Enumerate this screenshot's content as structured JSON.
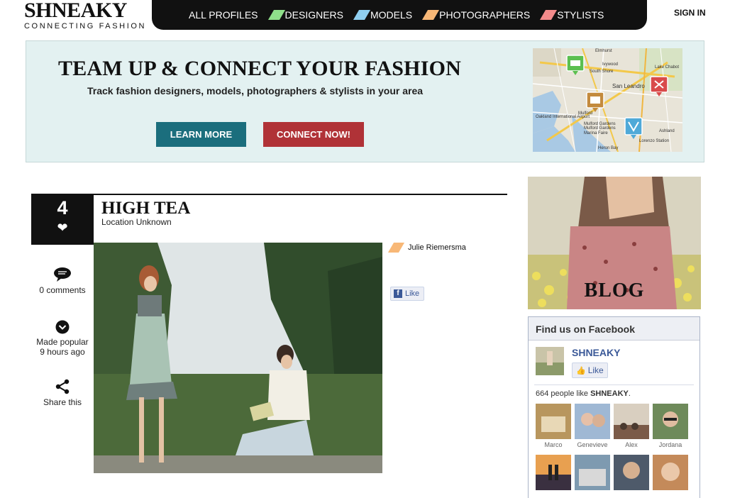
{
  "header": {
    "logo_title": "SHNEAKY",
    "logo_subtitle": "CONNECTING FASHION",
    "sign_in": "SIGN IN",
    "nav": [
      {
        "label": "ALL PROFILES",
        "color": ""
      },
      {
        "label": "DESIGNERS",
        "color": "#8fe08a"
      },
      {
        "label": "MODELS",
        "color": "#8fcff0"
      },
      {
        "label": "PHOTOGRAPHERS",
        "color": "#f8b877"
      },
      {
        "label": "STYLISTS",
        "color": "#f38b8b"
      }
    ]
  },
  "hero": {
    "title": "TEAM UP & CONNECT YOUR FASHION",
    "subtitle": "Track fashion designers, models, photographers & stylists in your area",
    "learn_more": "LEARN MORE",
    "connect_now": "CONNECT NOW!",
    "map_labels": [
      "Elmhurst",
      "Ivywood",
      "South Shore",
      "San Leandro",
      "Lake Chabot",
      "Mulford",
      "Mulford Gardens",
      "Mulford Gardens",
      "Marina Faire",
      "Ashland",
      "Lorenzo Station",
      "Heron Bay",
      "Oakland International Airport"
    ]
  },
  "post": {
    "like_count": "4",
    "title": "HIGH TEA",
    "location": "Location Unknown",
    "comments": "0 comments",
    "made_popular_line1": "Made popular",
    "made_popular_line2": "9 hours ago",
    "share": "Share this",
    "author": "Julie Riemersma",
    "author_color": "#f8b877",
    "fb_like": "Like"
  },
  "sidebar": {
    "blog_label": "BLOG",
    "facebook": {
      "heading": "Find us on Facebook",
      "page_name": "SHNEAKY",
      "like_label": "Like",
      "count_prefix": "664 people like",
      "count_page": "SHNEAKY",
      "count_suffix": ".",
      "fans": [
        "Marco",
        "Genevieve",
        "Alex",
        "Jordana"
      ]
    }
  }
}
